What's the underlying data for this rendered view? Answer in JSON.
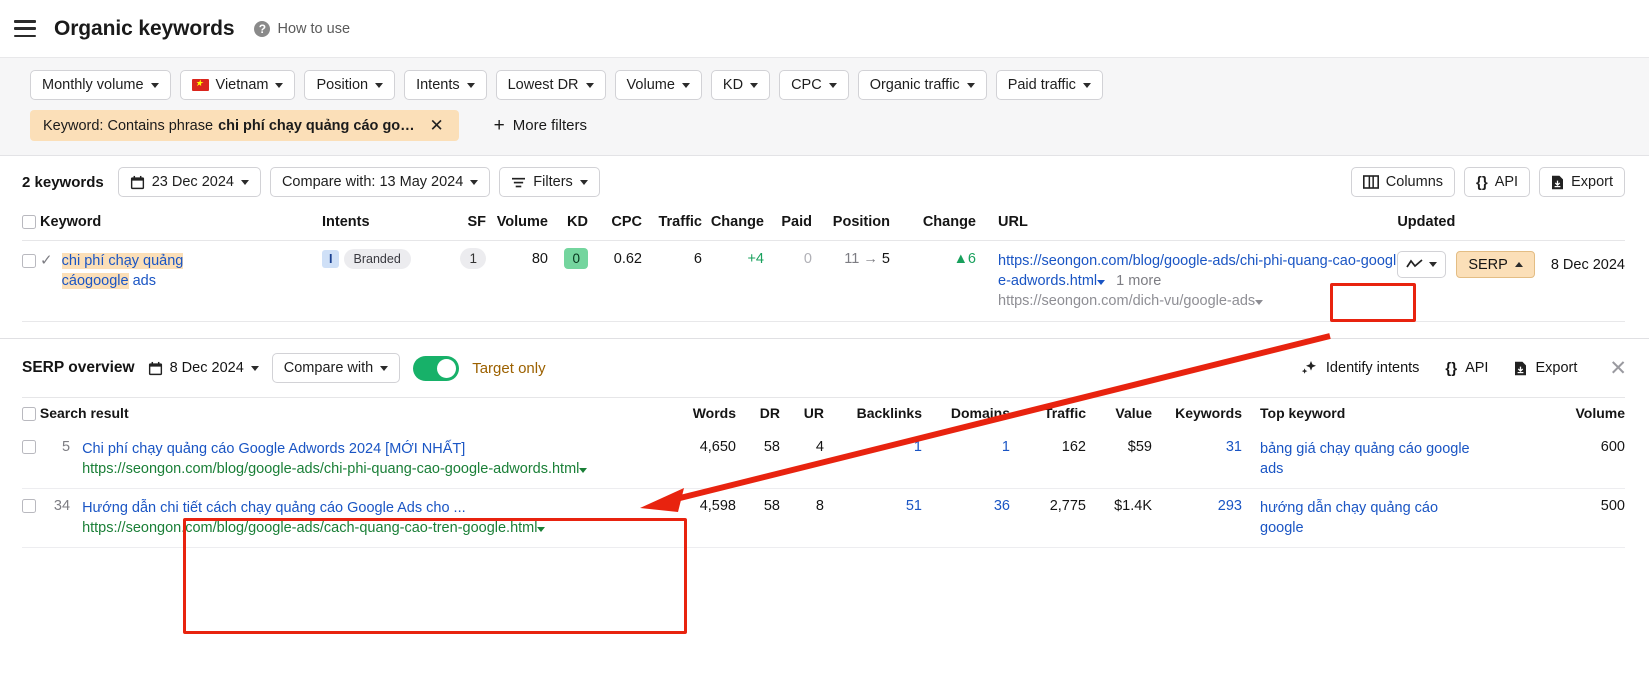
{
  "header": {
    "menu_icon": "hamburger-icon",
    "title": "Organic keywords",
    "help_icon": "question-circle-icon",
    "help_label": "How to use"
  },
  "filters": {
    "pills": [
      {
        "label": "Monthly volume",
        "icon": null
      },
      {
        "label": "Vietnam",
        "icon": "vietnam-flag-icon"
      },
      {
        "label": "Position",
        "icon": null
      },
      {
        "label": "Intents",
        "icon": null
      },
      {
        "label": "Lowest DR",
        "icon": null
      },
      {
        "label": "Volume",
        "icon": null
      },
      {
        "label": "KD",
        "icon": null
      },
      {
        "label": "CPC",
        "icon": null
      },
      {
        "label": "Organic traffic",
        "icon": null
      },
      {
        "label": "Paid traffic",
        "icon": null
      }
    ],
    "keyword_chip_prefix": "Keyword: Contains phrase",
    "keyword_chip_value": "chi phí chạy quảng cáo go…",
    "keyword_chip_close": "✕",
    "more_filters": "More filters"
  },
  "toolbar": {
    "keyword_count": "2 keywords",
    "date": "23 Dec 2024",
    "compare_with": "Compare with: 13 May 2024",
    "filters": "Filters",
    "columns": "Columns",
    "api": "API",
    "export": "Export"
  },
  "keywords_table": {
    "columns": [
      "Keyword",
      "Intents",
      "SF",
      "Volume",
      "KD",
      "CPC",
      "Traffic",
      "Change",
      "Paid",
      "Position",
      "Change",
      "URL",
      "Updated"
    ],
    "rows": [
      {
        "keyword_part1": "chi phí chạy quảng cáo",
        "keyword_part2": "google",
        "keyword_part3": " ads",
        "intent_badge": "I",
        "intent_label": "Branded",
        "sf": "1",
        "volume": "80",
        "kd": "0",
        "cpc": "0.62",
        "traffic": "6",
        "traffic_change": "+4",
        "paid": "0",
        "position_from": "11",
        "position_arrow": "→",
        "position_to": "5",
        "position_change": "▲6",
        "url_main": "https://seongon.com/blog/google-ads/chi-phi-quang-cao-google-adwords.html",
        "url_more": "1 more",
        "url_secondary": "https://seongon.com/dich-vu/google-ads",
        "serp_button": "SERP",
        "updated": "8 Dec 2024"
      }
    ]
  },
  "serp_overview": {
    "title": "SERP overview",
    "date": "8 Dec 2024",
    "compare_with": "Compare with",
    "target_only": "Target only",
    "identify_intents": "Identify intents",
    "api": "API",
    "export": "Export",
    "close_icon": "close-icon",
    "columns": [
      "Search result",
      "Words",
      "DR",
      "UR",
      "Backlinks",
      "Domains",
      "Traffic",
      "Value",
      "Keywords",
      "Top keyword",
      "Volume"
    ],
    "rows": [
      {
        "position": "5",
        "title": "Chi phí chạy quảng cáo Google Adwords 2024 [MỚI NHẤT]",
        "url": "https://seongon.com/blog/google-ads/chi-phi-quang-cao-google-adwords.html",
        "words": "4,650",
        "dr": "58",
        "ur": "4",
        "backlinks": "1",
        "domains": "1",
        "traffic": "162",
        "value": "$59",
        "keywords": "31",
        "top_keyword": "bảng giá chạy quảng cáo google ads",
        "volume": "600"
      },
      {
        "position": "34",
        "title": "Hướng dẫn chi tiết cách chạy quảng cáo Google Ads cho ...",
        "url": "https://seongon.com/blog/google-ads/cach-quang-cao-tren-google.html",
        "words": "4,598",
        "dr": "58",
        "ur": "8",
        "backlinks": "51",
        "domains": "36",
        "traffic": "2,775",
        "value": "$1.4K",
        "keywords": "293",
        "top_keyword": "hướng dẫn chạy quảng cáo google",
        "volume": "500"
      }
    ]
  },
  "annotations": {
    "color": "#e8230f",
    "serp_button_highlight": "red-box-around-serp-button",
    "results_highlight": "red-box-around-search-results",
    "arrow": "red-arrow-from-serp-button-to-results"
  }
}
